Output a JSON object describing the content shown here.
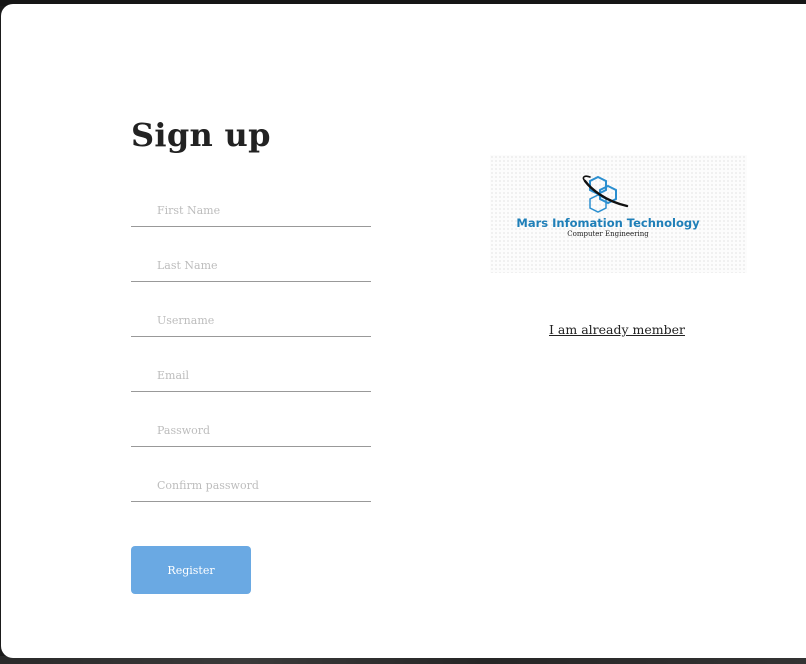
{
  "form": {
    "title": "Sign up",
    "fields": [
      {
        "name": "first-name",
        "placeholder": "First Name",
        "value": "",
        "icon": "person-icon"
      },
      {
        "name": "last-name",
        "placeholder": "Last Name",
        "value": "",
        "icon": "person-icon"
      },
      {
        "name": "username",
        "placeholder": "Username",
        "value": "",
        "icon": "person-icon"
      },
      {
        "name": "email",
        "placeholder": "Email",
        "value": "",
        "icon": "email-icon"
      },
      {
        "name": "password",
        "placeholder": "Password",
        "value": "",
        "icon": "lock-icon"
      },
      {
        "name": "confirm-password",
        "placeholder": "Confirm password",
        "value": "",
        "icon": "lock-icon"
      }
    ],
    "register_label": "Register"
  },
  "logo": {
    "company_name": "Mars Infomation Technology",
    "tagline": "Computer Engineering",
    "brand_color": "#1f7fb8"
  },
  "links": {
    "already_member": "I am already member"
  },
  "colors": {
    "register_button": "#6aa9e3",
    "card_background": "#ffffff",
    "page_background": "#1b1b1b"
  }
}
